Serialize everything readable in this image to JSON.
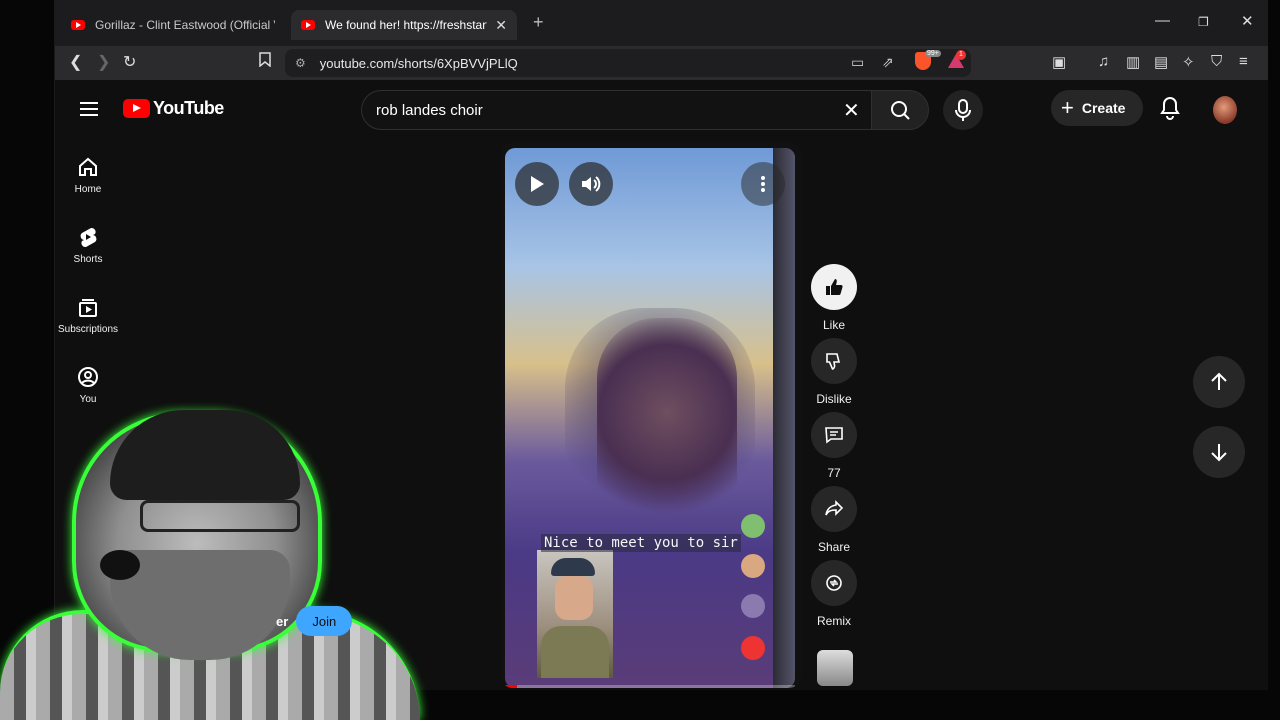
{
  "browser": {
    "tabs": [
      {
        "title": "Gorillaz - Clint Eastwood (Official Vid",
        "active": false
      },
      {
        "title": "We found her! https://freshstart",
        "active": true
      }
    ],
    "new_tab": "+",
    "url": "youtube.com/shorts/6XpBVVjPLlQ",
    "brave_badge": "99+",
    "rewards_badge": "1"
  },
  "youtube": {
    "logo_text": "YouTube",
    "search": {
      "value": "rob landes choir"
    },
    "create_label": "Create",
    "sidebar": [
      {
        "label": "Home",
        "icon": "home-icon"
      },
      {
        "label": "Shorts",
        "icon": "shorts-icon"
      },
      {
        "label": "Subscriptions",
        "icon": "subscriptions-icon"
      },
      {
        "label": "You",
        "icon": "you-icon"
      }
    ],
    "short": {
      "caption": "Nice to meet you to sir",
      "progress": 0.04
    },
    "actions": {
      "like": "Like",
      "dislike": "Dislike",
      "comments": "77",
      "share": "Share",
      "remix": "Remix"
    },
    "join_partial": "er",
    "join_label": "Join"
  },
  "colors": {
    "brand_red": "#ff0000",
    "join_blue": "#3ea6ff",
    "webcam_outline": "#39ff39"
  }
}
